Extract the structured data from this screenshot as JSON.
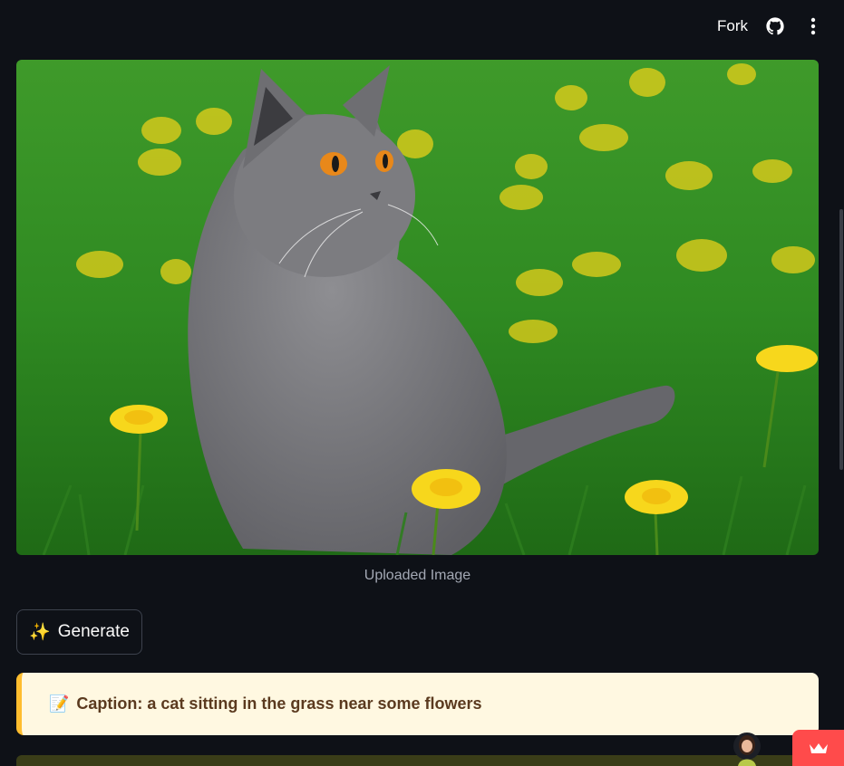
{
  "toolbar": {
    "fork_label": "Fork",
    "github_icon": "github-icon",
    "menu_icon": "vertical-ellipsis-icon"
  },
  "image": {
    "caption": "Uploaded Image"
  },
  "generate_button": {
    "icon": "✨",
    "label": "Generate"
  },
  "result": {
    "icon": "📝",
    "text": "Caption: a cat sitting in the grass near some flowers"
  },
  "colors": {
    "background": "#0e1117",
    "alert_bg": "#fff8e1",
    "alert_border": "#ffbd2e",
    "alert_text": "#5b3a1f",
    "badge": "#ff4b4b"
  }
}
